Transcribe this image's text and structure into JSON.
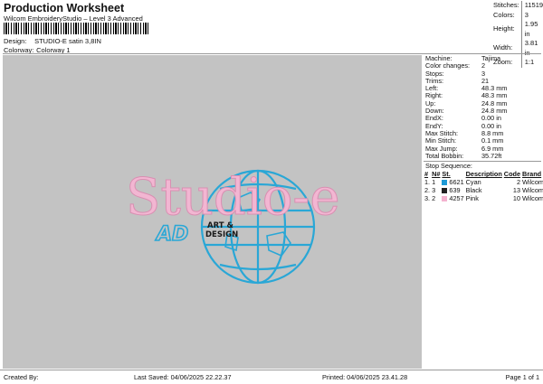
{
  "header": {
    "title": "Production Worksheet",
    "subtitle": "Wilcom EmbroideryStudio – Level 3 Advanced",
    "design_label": "Design:",
    "design_value": "STUDIO-E satin 3,8IN",
    "colorway_label": "Colorway:",
    "colorway_value": "Colorway 1"
  },
  "top_stats": [
    {
      "label": "Stitches:",
      "value": "11519"
    },
    {
      "label": "Colors:",
      "value": "3"
    },
    {
      "label": "Height:",
      "value": "1.95 in"
    },
    {
      "label": "Width:",
      "value": "3.81 in"
    },
    {
      "label": "Zoom:",
      "value": "1:1"
    }
  ],
  "design": {
    "main_text": "Studio-e",
    "ad_text": "AD",
    "art_text": "ART &",
    "design_text": "DESIGN",
    "colors": {
      "pink": "#f2b6d2",
      "cyan": "#2aa7d6",
      "black": "#1a1a1a",
      "background": "#c3c3c3"
    }
  },
  "machine_stats": [
    {
      "label": "Machine:",
      "value": "Tajima"
    },
    {
      "label": "Color changes:",
      "value": "2"
    },
    {
      "label": "Stops:",
      "value": "3"
    },
    {
      "label": "Trims:",
      "value": "21"
    },
    {
      "label": "Left:",
      "value": "48.3 mm"
    },
    {
      "label": "Right:",
      "value": "48.3 mm"
    },
    {
      "label": "Up:",
      "value": "24.8 mm"
    },
    {
      "label": "Down:",
      "value": "24.8 mm"
    },
    {
      "label": "EndX:",
      "value": "0.00 in"
    },
    {
      "label": "EndY:",
      "value": "0.00 in"
    },
    {
      "label": "Max Stitch:",
      "value": "8.8 mm"
    },
    {
      "label": "Min Stitch:",
      "value": "0.1 mm"
    },
    {
      "label": "Max Jump:",
      "value": "6.9 mm"
    },
    {
      "label": "Total Bobbin:",
      "value": "35.72ft"
    }
  ],
  "stop_sequence": {
    "title": "Stop Sequence:",
    "headers": [
      "#",
      "N#",
      "St.",
      "Description",
      "Code",
      "Brand"
    ],
    "rows": [
      {
        "num": "1.",
        "n": "1",
        "color": "#1e9ad6",
        "st": "6621",
        "desc": "Cyan",
        "code": "2",
        "brand": "Wilcom"
      },
      {
        "num": "2.",
        "n": "3",
        "color": "#222222",
        "st": "639",
        "desc": "Black",
        "code": "13",
        "brand": "Wilcom"
      },
      {
        "num": "3.",
        "n": "2",
        "color": "#f4b2cf",
        "st": "4257",
        "desc": "Pink",
        "code": "10",
        "brand": "Wilcom"
      }
    ]
  },
  "footer": {
    "created_by": "Created By:",
    "last_saved": "Last Saved: 04/06/2025 22.22.37",
    "printed": "Printed: 04/06/2025 23.41.28",
    "page": "Page 1 of 1"
  }
}
